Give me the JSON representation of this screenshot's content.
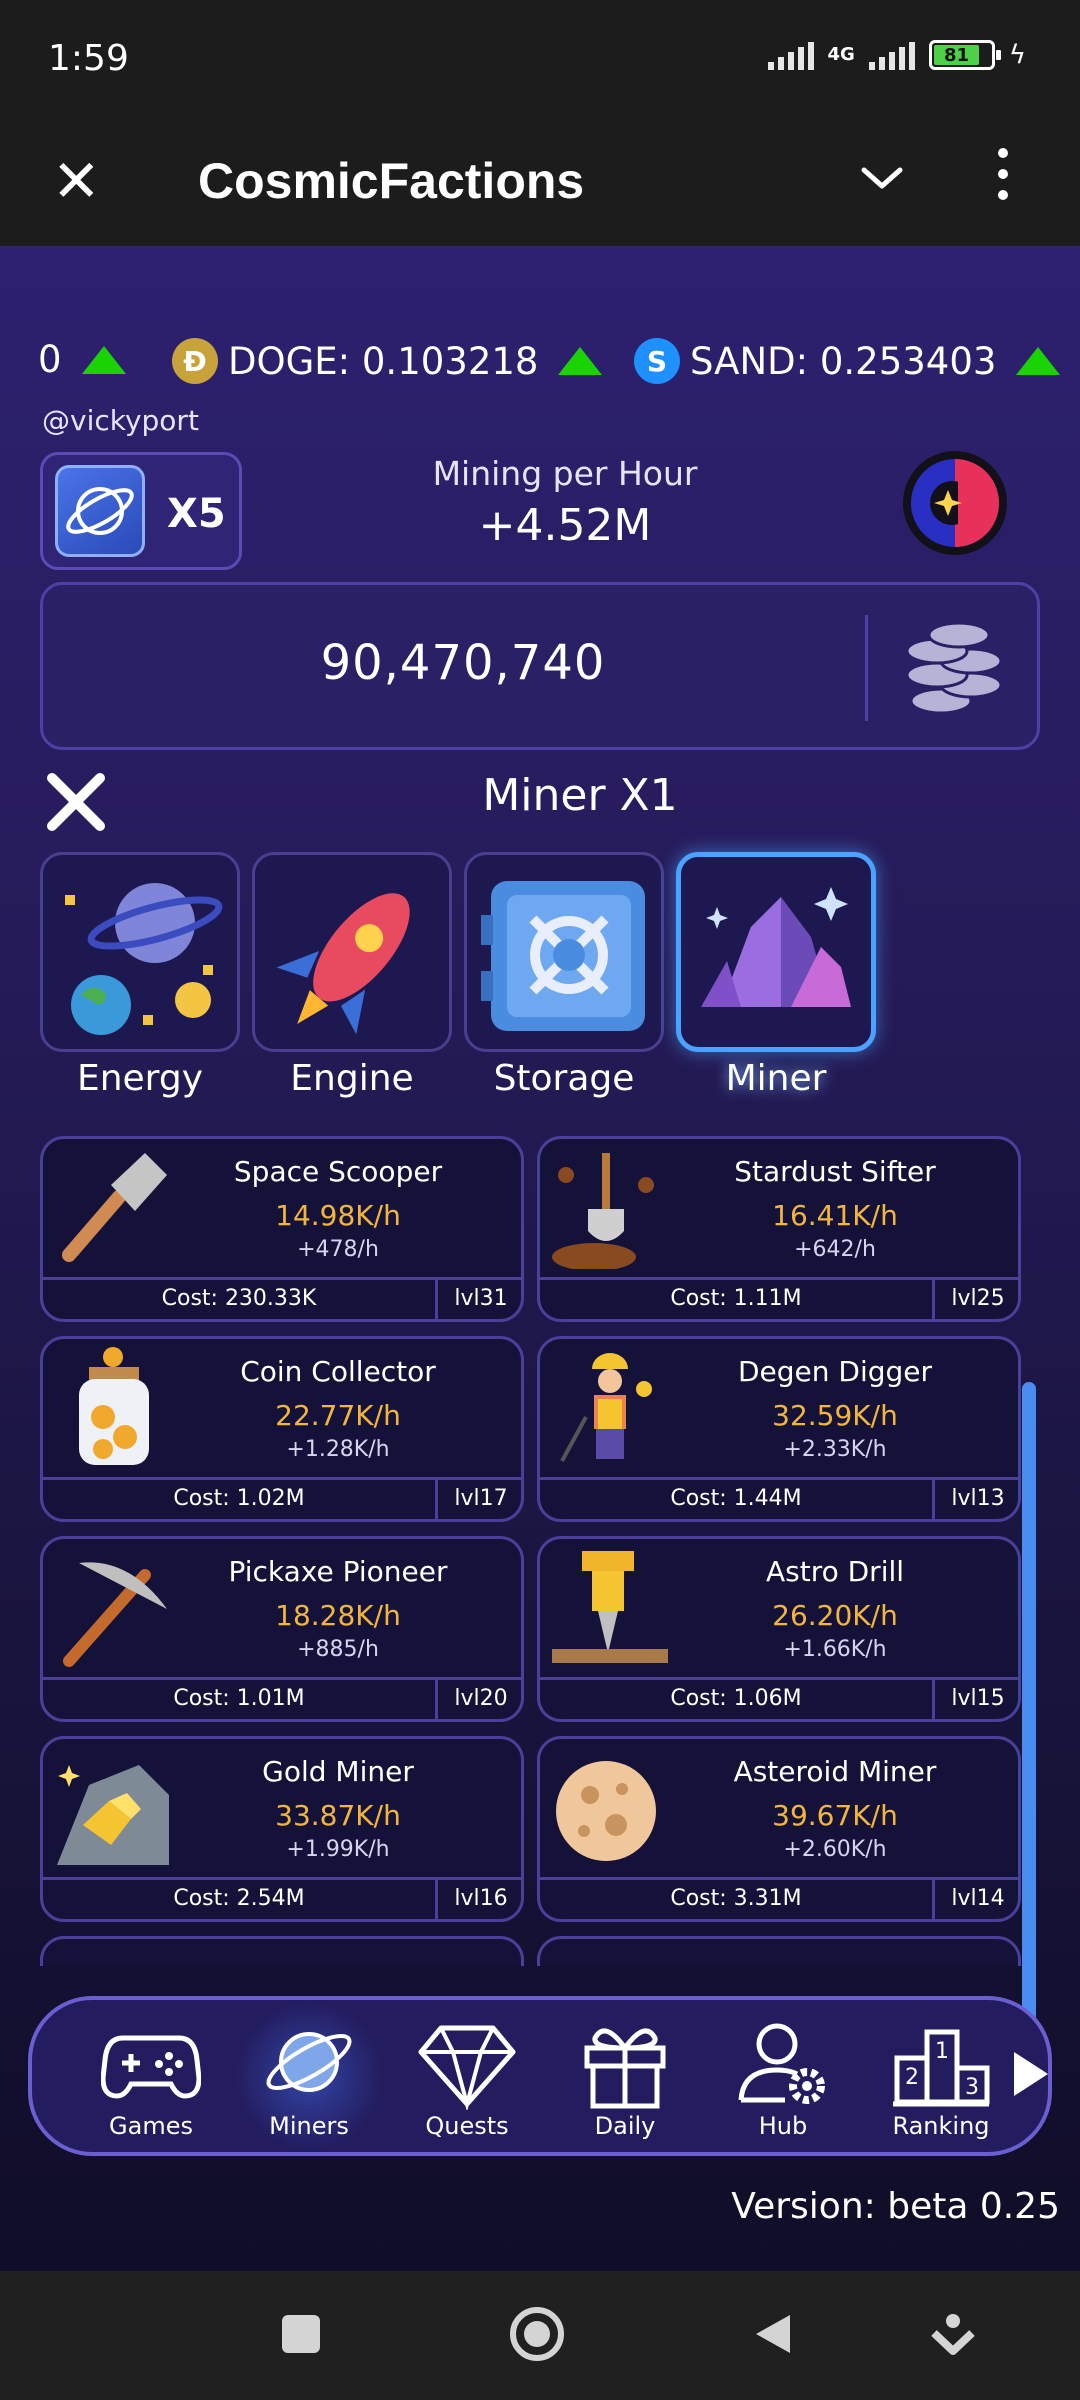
{
  "status": {
    "time": "1:59",
    "network": "4G",
    "battery": "81"
  },
  "appbar": {
    "title": "CosmicFactions"
  },
  "ticker": [
    {
      "text": "0",
      "icon": "none"
    },
    {
      "text": "DOGE: 0.103218",
      "badge": "Ð",
      "color": "#c8a23a"
    },
    {
      "text": "SAND: 0.253403",
      "badge": "S",
      "color": "#1e90ff"
    }
  ],
  "user": {
    "handle": "@vickyport"
  },
  "multiplier": {
    "label": "X5"
  },
  "mining": {
    "title": "Mining per Hour",
    "value": "+4.52M"
  },
  "balance": {
    "value": "90,470,740"
  },
  "section": {
    "title": "Miner X1"
  },
  "categories": [
    {
      "label": "Energy",
      "icon": "planet-energy-icon"
    },
    {
      "label": "Engine",
      "icon": "rocket-icon"
    },
    {
      "label": "Storage",
      "icon": "vault-icon"
    },
    {
      "label": "Miner",
      "icon": "crystal-icon",
      "active": true
    }
  ],
  "cards": [
    {
      "name": "Space Scooper",
      "rate": "14.98K/h",
      "inc": "+478/h",
      "cost": "Cost: 230.33K",
      "lvl": "lvl31",
      "icon": "scoop-icon"
    },
    {
      "name": "Stardust Sifter",
      "rate": "16.41K/h",
      "inc": "+642/h",
      "cost": "Cost: 1.11M",
      "lvl": "lvl25",
      "icon": "shovel-icon"
    },
    {
      "name": "Coin Collector",
      "rate": "22.77K/h",
      "inc": "+1.28K/h",
      "cost": "Cost: 1.02M",
      "lvl": "lvl17",
      "icon": "coin-jar-icon"
    },
    {
      "name": "Degen Digger",
      "rate": "32.59K/h",
      "inc": "+2.33K/h",
      "cost": "Cost: 1.44M",
      "lvl": "lvl13",
      "icon": "miner-person-icon"
    },
    {
      "name": "Pickaxe Pioneer",
      "rate": "18.28K/h",
      "inc": "+885/h",
      "cost": "Cost: 1.01M",
      "lvl": "lvl20",
      "icon": "pickaxe-icon"
    },
    {
      "name": "Astro Drill",
      "rate": "26.20K/h",
      "inc": "+1.66K/h",
      "cost": "Cost: 1.06M",
      "lvl": "lvl15",
      "icon": "drill-icon"
    },
    {
      "name": "Gold Miner",
      "rate": "33.87K/h",
      "inc": "+1.99K/h",
      "cost": "Cost: 2.54M",
      "lvl": "lvl16",
      "icon": "gold-ore-icon"
    },
    {
      "name": "Asteroid Miner",
      "rate": "39.67K/h",
      "inc": "+2.60K/h",
      "cost": "Cost: 3.31M",
      "lvl": "lvl14",
      "icon": "asteroid-icon"
    }
  ],
  "nav": [
    {
      "label": "Games",
      "icon": "gamepad-icon"
    },
    {
      "label": "Miners",
      "icon": "planet-icon",
      "active": true
    },
    {
      "label": "Quests",
      "icon": "diamond-icon"
    },
    {
      "label": "Daily",
      "icon": "gift-icon"
    },
    {
      "label": "Hub",
      "icon": "user-settings-icon"
    },
    {
      "label": "Ranking",
      "icon": "podium-icon"
    }
  ],
  "footer": {
    "version": "Version: beta 0.25"
  },
  "colors": {
    "accent": "#4aa3ff",
    "rate": "#f3b53a",
    "up": "#19d400",
    "bg": "#2d2170"
  }
}
